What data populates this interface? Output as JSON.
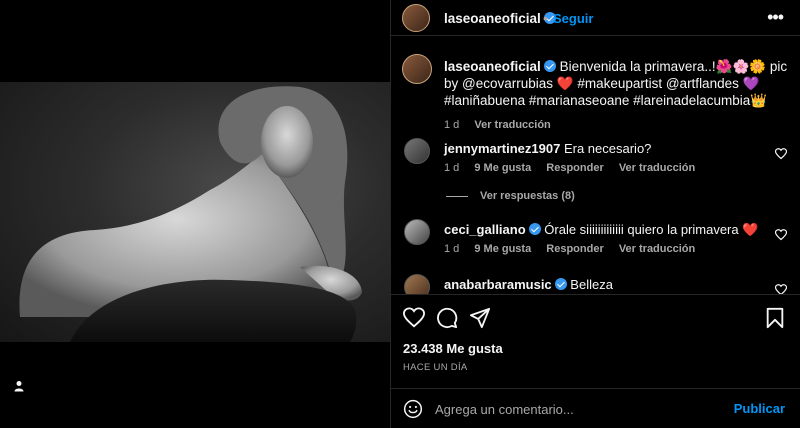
{
  "header": {
    "username": "laseoaneoficial",
    "follow_label": "Seguir",
    "more_icon": "more-horizontal-icon"
  },
  "caption": {
    "username": "laseoaneoficial",
    "text": "Bienvenida la primavera..!🌺🌸🌼 pic by @ecovarrubias ❤️ #makeupartist @artflandes 💜 #laniñabuena #marianaseoane #lareinadelacumbia👑",
    "time": "1 d",
    "translate": "Ver traducción"
  },
  "comments": [
    {
      "username": "jennymartinez1907",
      "verified": false,
      "text": "Era necesario?",
      "time": "1 d",
      "likes": "9 Me gusta",
      "reply": "Responder",
      "translate": "Ver traducción"
    },
    {
      "username": "ceci_galliano",
      "verified": true,
      "text": "Órale siiiiiiiiiiiii quiero la primavera ❤️",
      "time": "1 d",
      "likes": "9 Me gusta",
      "reply": "Responder",
      "translate": "Ver traducción"
    },
    {
      "username": "anabarbaramusic",
      "verified": true,
      "text": "Belleza"
    }
  ],
  "view_replies": "Ver respuestas (8)",
  "likes_count": "23.438 Me gusta",
  "posted_ago": "HACE UN DÍA",
  "comment_box": {
    "placeholder": "Agrega un comentario...",
    "publish_label": "Publicar"
  },
  "colors": {
    "accent": "#0095f6",
    "verified": "#3897f0",
    "background": "#000000",
    "muted_text": "#a8a8a8"
  }
}
